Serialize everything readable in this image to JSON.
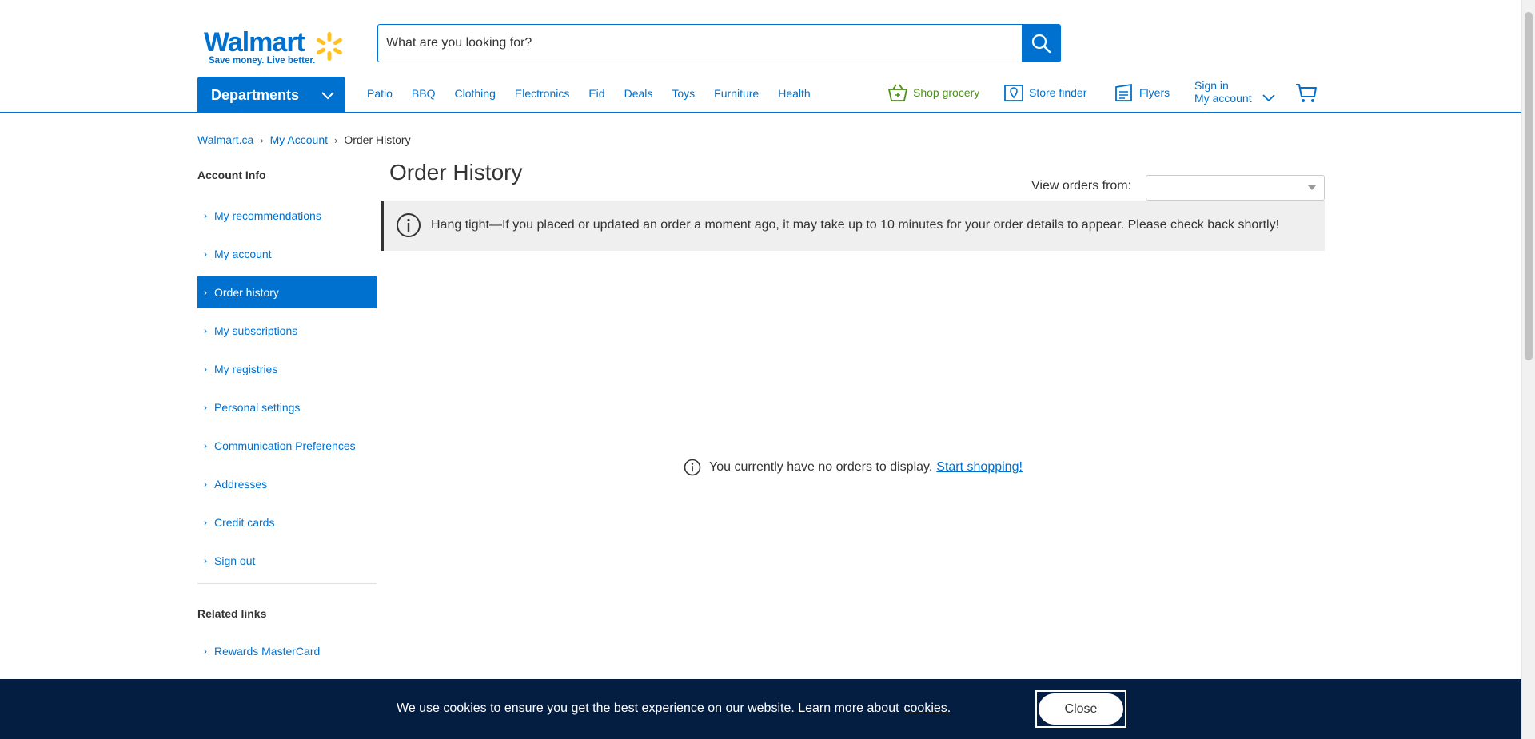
{
  "header": {
    "logo_word": "Walmart",
    "logo_tagline": "Save money. Live better.",
    "search_placeholder": "What are you looking for?",
    "departments_label": "Departments",
    "nav_links": [
      "Patio",
      "BBQ",
      "Clothing",
      "Electronics",
      "Eid",
      "Deals",
      "Toys",
      "Furniture",
      "Health"
    ],
    "shop_grocery": "Shop grocery",
    "store_finder": "Store finder",
    "flyers": "Flyers",
    "sign_in": "Sign in",
    "my_account": "My account",
    "colors": {
      "brand_blue": "#0071ce",
      "spark_yellow": "#ffc220",
      "grocery_green": "#4c8f19"
    }
  },
  "breadcrumb": {
    "items": [
      "Walmart.ca",
      "My Account"
    ],
    "current": "Order History"
  },
  "sidebar": {
    "account_heading": "Account Info",
    "items": [
      {
        "label": "My recommendations",
        "active": false
      },
      {
        "label": "My account",
        "active": false
      },
      {
        "label": "Order history",
        "active": true
      },
      {
        "label": "My subscriptions",
        "active": false
      },
      {
        "label": "My registries",
        "active": false
      },
      {
        "label": "Personal settings",
        "active": false
      },
      {
        "label": "Communication Preferences",
        "active": false
      },
      {
        "label": "Addresses",
        "active": false
      },
      {
        "label": "Credit cards",
        "active": false
      },
      {
        "label": "Sign out",
        "active": false
      }
    ],
    "related_heading": "Related links",
    "related_items": [
      {
        "label": "Rewards MasterCard"
      }
    ]
  },
  "main": {
    "title": "Order History",
    "view_orders_label": "View orders from:",
    "view_orders_value": "",
    "notice": "Hang tight—If you placed or updated an order a moment ago, it may take up to 10 minutes for your order details to appear. Please check back shortly!",
    "empty_message": "You currently have no orders to display.",
    "start_shopping": "Start shopping!"
  },
  "cookie_banner": {
    "message": "We use cookies to ensure you get the best experience on our website. Learn more about",
    "link": "cookies.",
    "close": "Close",
    "bg_color": "#041e42"
  }
}
